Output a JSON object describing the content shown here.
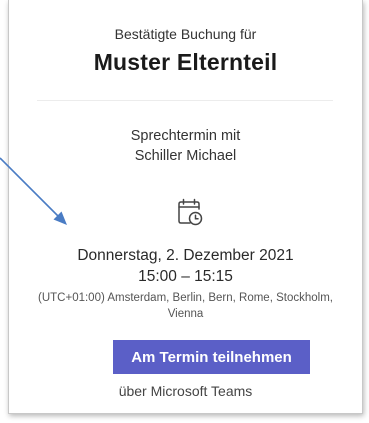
{
  "header": {
    "subtitle": "Bestätigte Buchung für",
    "title": "Muster Elternteil"
  },
  "meeting": {
    "type_line": "Sprechtermin mit",
    "host_line": "Schiller Michael"
  },
  "schedule": {
    "date": "Donnerstag, 2. Dezember 2021",
    "time": "15:00 – 15:15",
    "timezone_line1": "(UTC+01:00) Amsterdam, Berlin, Bern, Rome, Stockholm,",
    "timezone_line2": "Vienna",
    "icon": "calendar-clock-icon"
  },
  "actions": {
    "join_label": "Am Termin teilnehmen",
    "via_label": "über Microsoft Teams"
  },
  "colors": {
    "button": "#5b5fc7",
    "arrow": "#4a7cc4"
  }
}
